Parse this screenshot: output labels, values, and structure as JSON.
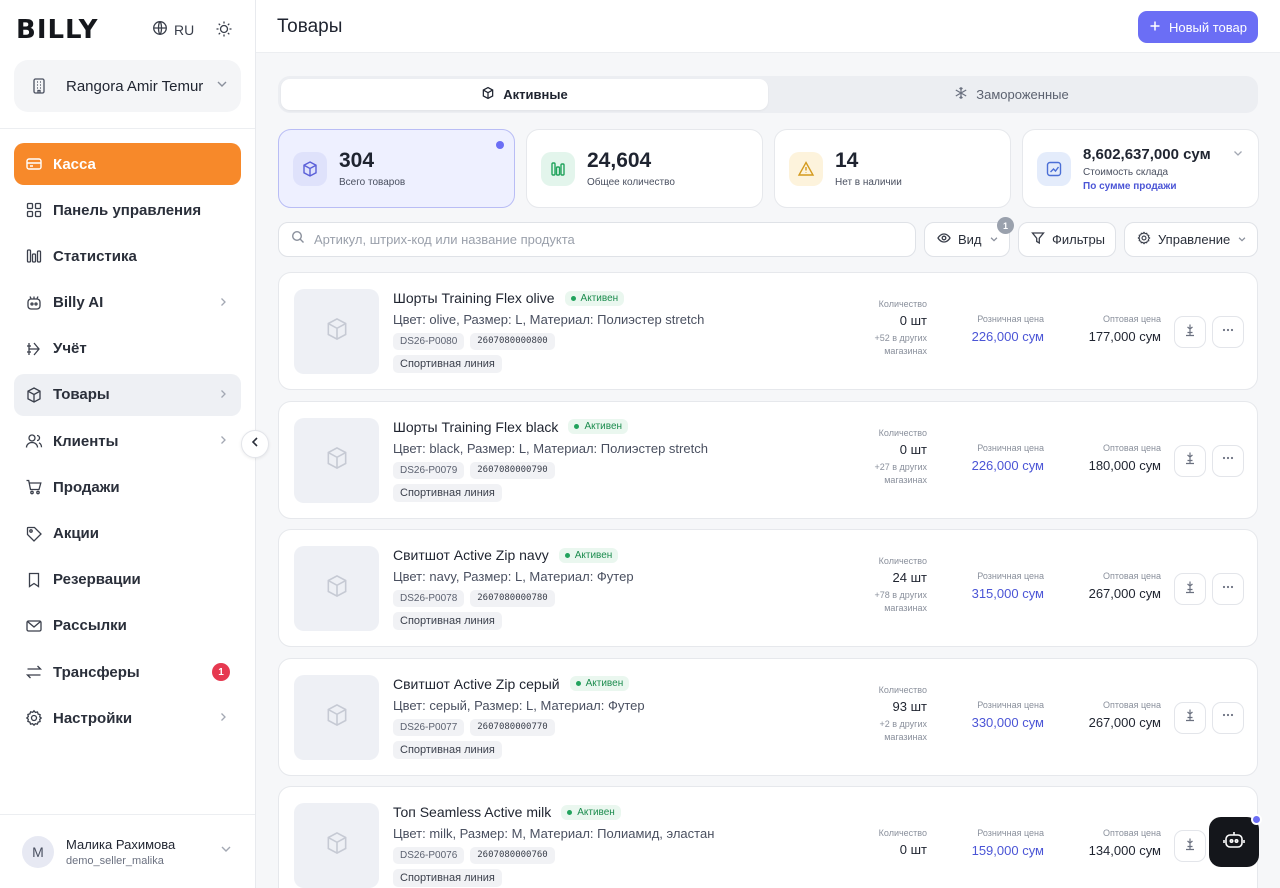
{
  "brand": {
    "logo": "BILLY",
    "language": "RU"
  },
  "store": {
    "name": "Rangora Amir Temur"
  },
  "nav": [
    {
      "label": "Касса",
      "icon": "cash-register-icon",
      "state": "active"
    },
    {
      "label": "Панель управления",
      "icon": "dashboard-icon"
    },
    {
      "label": "Статистика",
      "icon": "chart-icon"
    },
    {
      "label": "Billy AI",
      "icon": "robot-icon",
      "has_submenu": true
    },
    {
      "label": "Учёт",
      "icon": "accounting-icon"
    },
    {
      "label": "Товары",
      "icon": "box-icon",
      "state": "selected",
      "has_submenu": true
    },
    {
      "label": "Клиенты",
      "icon": "users-icon",
      "has_submenu": true
    },
    {
      "label": "Продажи",
      "icon": "cart-icon"
    },
    {
      "label": "Акции",
      "icon": "tag-icon"
    },
    {
      "label": "Резервации",
      "icon": "bookmark-icon"
    },
    {
      "label": "Рассылки",
      "icon": "mail-icon"
    },
    {
      "label": "Трансферы",
      "icon": "transfer-icon",
      "badge": "1"
    },
    {
      "label": "Настройки",
      "icon": "gear-icon",
      "has_submenu": true
    }
  ],
  "user": {
    "initial": "М",
    "name": "Малика Рахимова",
    "login": "demo_seller_malika"
  },
  "header": {
    "title": "Товары",
    "new_button": "Новый товар"
  },
  "tabs": [
    {
      "label": "Активные",
      "active": true
    },
    {
      "label": "Замороженные",
      "active": false
    }
  ],
  "stats": [
    {
      "value": "304",
      "label": "Всего товаров"
    },
    {
      "value": "24,604",
      "label": "Общее количество"
    },
    {
      "value": "14",
      "label": "Нет в наличии"
    },
    {
      "value": "8,602,637,000 сум",
      "label": "Стоимость склада",
      "link": "По сумме продажи"
    }
  ],
  "search": {
    "placeholder": "Артикул, штрих-код или название продукта",
    "value": ""
  },
  "toolbar": {
    "view": "Вид",
    "view_badge": "1",
    "filters": "Фильтры",
    "manage": "Управление"
  },
  "columns": {
    "qty": "Количество",
    "retail": "Розничная цена",
    "wholesale": "Оптовая цена"
  },
  "products": [
    {
      "name": "Шорты Training Flex olive",
      "status": "Активен",
      "attrs": "Цвет: olive, Размер: L, Материал: Полиэстер stretch",
      "sku": "DS26-P0080",
      "barcode": "2607080000800",
      "tag": "Спортивная линия",
      "qty": "0 шт",
      "other": "+52 в других магазинах",
      "retail": "226,000 сум",
      "wholesale": "177,000 сум"
    },
    {
      "name": "Шорты Training Flex black",
      "status": "Активен",
      "attrs": "Цвет: black, Размер: L, Материал: Полиэстер stretch",
      "sku": "DS26-P0079",
      "barcode": "2607080000790",
      "tag": "Спортивная линия",
      "qty": "0 шт",
      "other": "+27 в других магазинах",
      "retail": "226,000 сум",
      "wholesale": "180,000 сум"
    },
    {
      "name": "Свитшот Active Zip navy",
      "status": "Активен",
      "attrs": "Цвет: navy, Размер: L, Материал: Футер",
      "sku": "DS26-P0078",
      "barcode": "2607080000780",
      "tag": "Спортивная линия",
      "qty": "24 шт",
      "other": "+78 в других магазинах",
      "retail": "315,000 сум",
      "wholesale": "267,000 сум"
    },
    {
      "name": "Свитшот Active Zip серый",
      "status": "Активен",
      "attrs": "Цвет: серый, Размер: L, Материал: Футер",
      "sku": "DS26-P0077",
      "barcode": "2607080000770",
      "tag": "Спортивная линия",
      "qty": "93 шт",
      "other": "+2 в других магазинах",
      "retail": "330,000 сум",
      "wholesale": "267,000 сум"
    },
    {
      "name": "Топ Seamless Active milk",
      "status": "Активен",
      "attrs": "Цвет: milk, Размер: M, Материал: Полиамид, эластан",
      "sku": "DS26-P0076",
      "barcode": "2607080000760",
      "tag": "Спортивная линия",
      "qty": "0 шт",
      "other": "",
      "retail": "159,000 сум",
      "wholesale": "134,000 сум"
    }
  ],
  "colors": {
    "accent": "#6b6ef5",
    "active_nav": "#f7892a",
    "status_green": "#1c8c4e",
    "price_blue": "#4b55d6"
  }
}
